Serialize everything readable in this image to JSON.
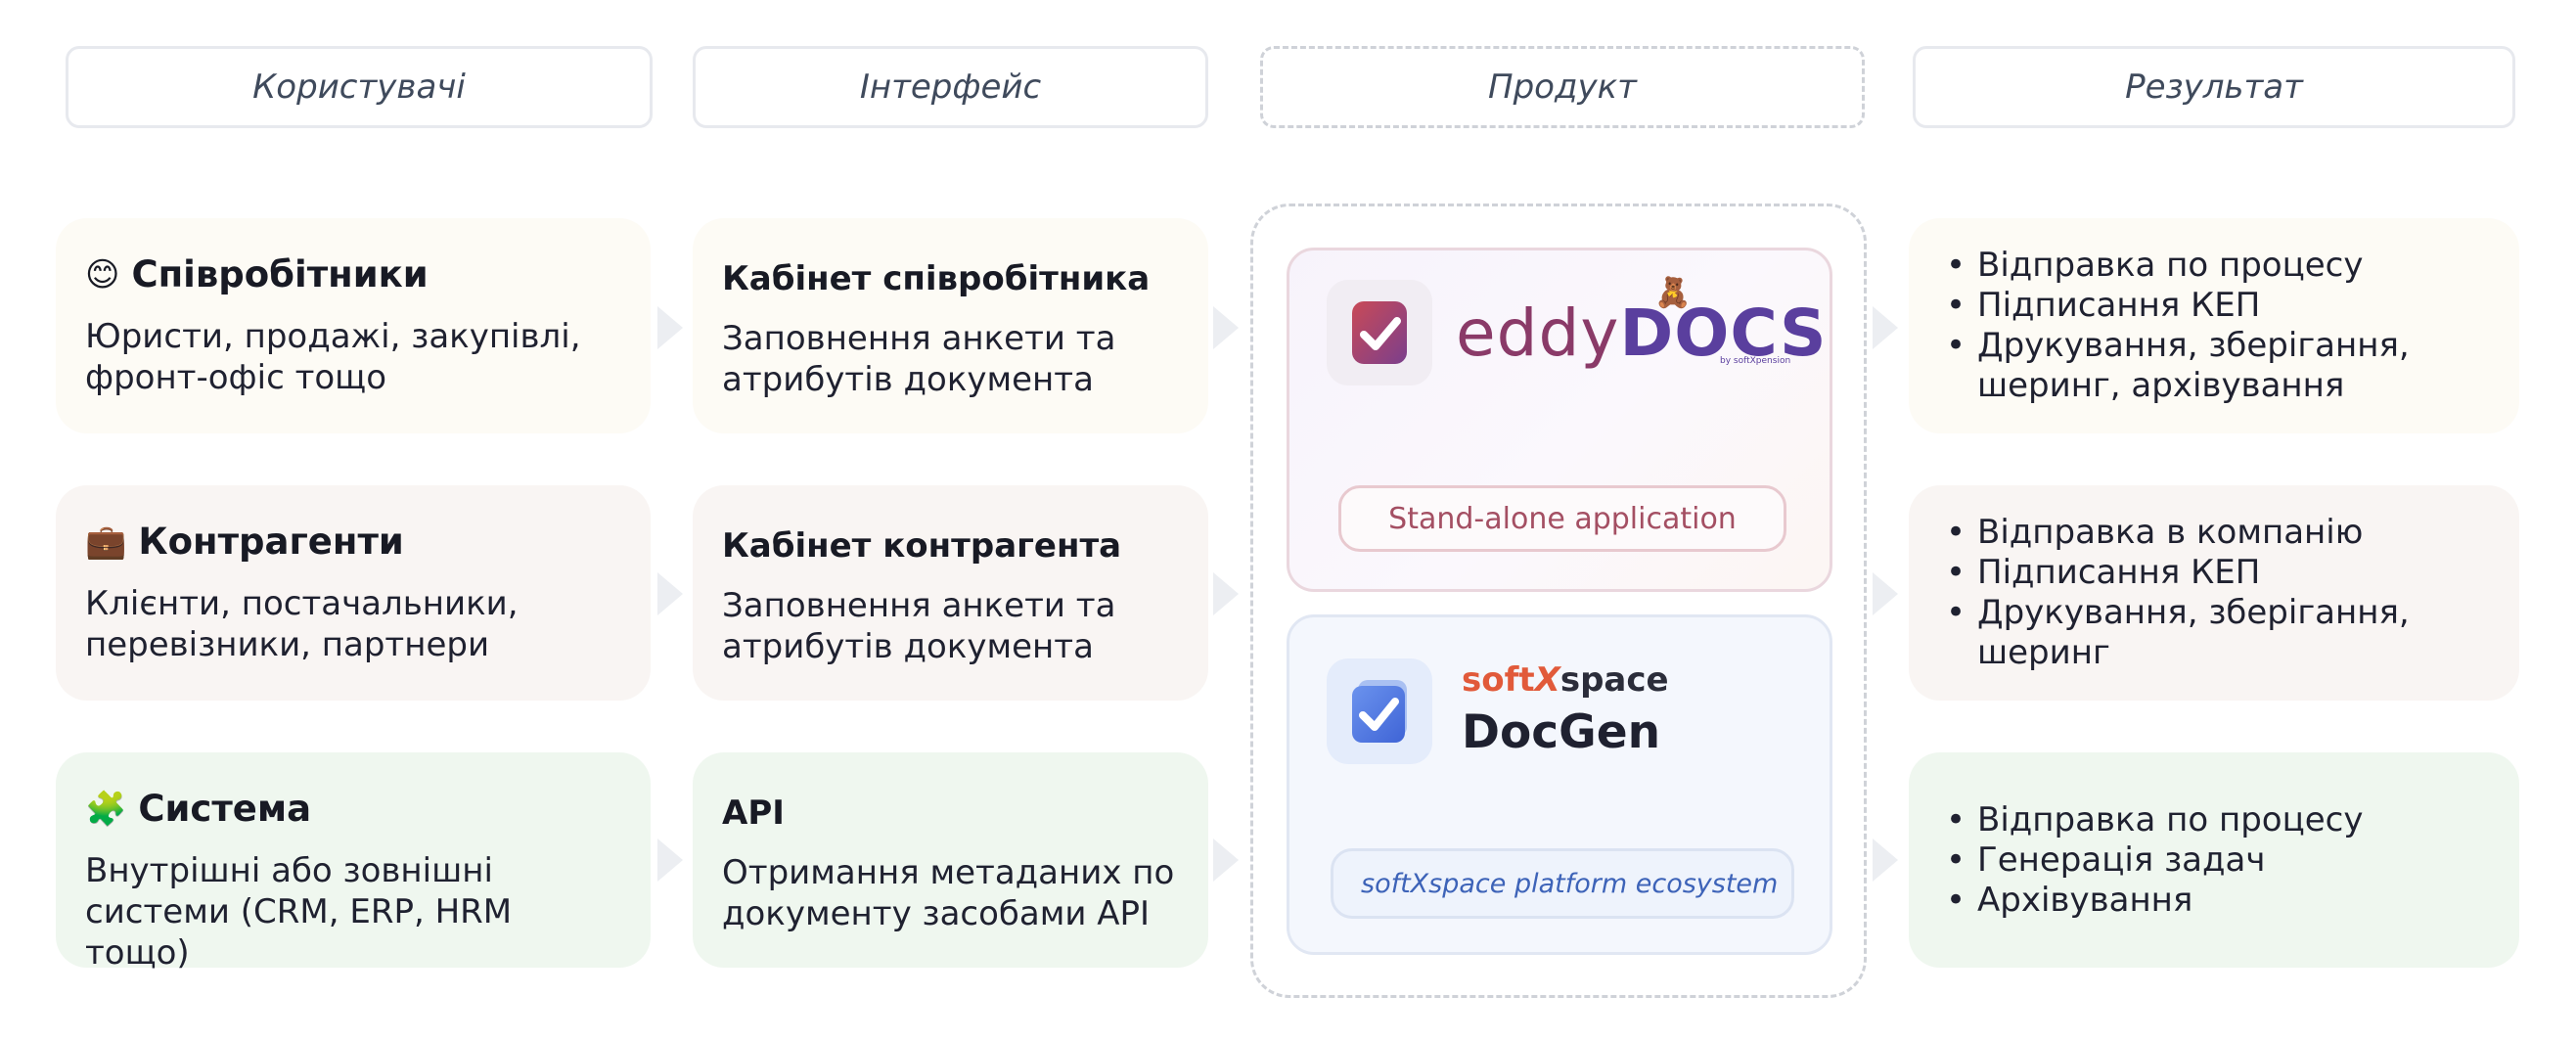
{
  "headers": {
    "users": "Користувачі",
    "interface": "Інтерфейс",
    "product": "Продукт",
    "result": "Результат"
  },
  "users": [
    {
      "emoji": "😊",
      "title": "Співробітники",
      "body": "Юристи, продажі, закупівлі, фронт-офіс тощо"
    },
    {
      "emoji": "💼",
      "title": "Контрагенти",
      "body": "Клієнти, постачальники, перевізники, партнери"
    },
    {
      "emoji": "🧩",
      "title": "Система",
      "body": "Внутрішні або зовнішні системи (CRM, ERP, HRM тощо)"
    }
  ],
  "interfaces": [
    {
      "title": "Кабінет співробітника",
      "body": "Заповнення анкети та атрибутів документа"
    },
    {
      "title": "Кабінет контрагента",
      "body": "Заповнення анкети та атрибутів документа"
    },
    {
      "title": "API",
      "body": "Отримання метаданих по документу засобами API"
    }
  ],
  "product": {
    "eddy": {
      "wordmark_light": "eddy",
      "wordmark_bold": "DOCS",
      "sub": "by softXpension",
      "pill": "Stand-alone application"
    },
    "softxspace": {
      "brand_soft": "soft",
      "brand_x": "X",
      "brand_space": "space",
      "product": "DocGen",
      "pill": "softXspace platform ecosystem"
    }
  },
  "results": [
    [
      "Відправка по процесу",
      "Підписання КЕП",
      "Друкування, зберігання, шеринг, архівування"
    ],
    [
      "Відправка в компанію",
      "Підписання КЕП",
      "Друкування, зберігання, шеринг"
    ],
    [
      "Відправка по процесу",
      "Генерація задач",
      "Архівування"
    ]
  ],
  "colors": {
    "yellow_card": "#fdfbf5",
    "rose_card": "#f9f5f3",
    "green_card": "#eff7ef",
    "eddy_accent": "#5a3f9e",
    "softxspace_accent": "#e15a3a",
    "docgen_blue": "#3d63b8"
  }
}
